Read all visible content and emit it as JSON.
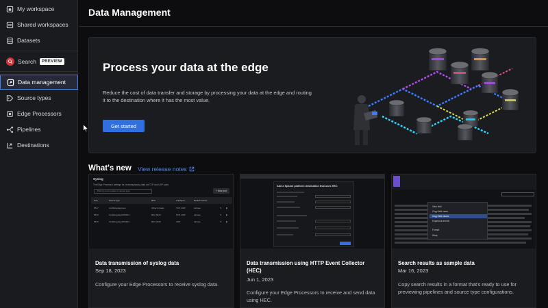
{
  "sidebar": {
    "items": [
      {
        "label": "My workspace",
        "icon": "home-icon"
      },
      {
        "label": "Shared workspaces",
        "icon": "shared-icon"
      },
      {
        "label": "Datasets",
        "icon": "database-icon"
      },
      {
        "label": "Search",
        "icon": "search-icon",
        "badge": "PREVIEW"
      },
      {
        "label": "Data management",
        "icon": "data-management-icon",
        "active": true
      },
      {
        "label": "Source types",
        "icon": "tag-icon"
      },
      {
        "label": "Edge Processors",
        "icon": "processor-icon"
      },
      {
        "label": "Pipelines",
        "icon": "pipeline-icon"
      },
      {
        "label": "Destinations",
        "icon": "destination-icon"
      }
    ]
  },
  "page": {
    "title": "Data Management"
  },
  "hero": {
    "heading": "Process your data at the edge",
    "description": "Reduce the cost of data transfer and storage by processing your data at the edge and routing it to the destination where it has the most value.",
    "cta": "Get started"
  },
  "whats_new": {
    "title": "What's new",
    "link": "View release notes",
    "cards": [
      {
        "title": "Data transmission of syslog data",
        "date": "Sep 18, 2023",
        "description": "Configure your Edge Processors to receive syslog data.",
        "thumb": {
          "heading": "Syslog",
          "subtitle": "The Edge Processor settings for receiving syslog data via TCP and UDP ports.",
          "filter_placeholder": "Filter by port number or source type",
          "new_port": "+ New port",
          "columns": [
            "Port",
            "Source type",
            "RFC",
            "Transport",
            "Default source"
          ],
          "rows": [
            [
              "5517",
              "zsm5cisyslog:mes",
              "Other formats",
              "TCP, UDP",
              "tunlnee"
            ],
            [
              "5516",
              "zsm5cisyslog:RC5424",
              "RFC 5424",
              "TCP, UDP",
              "tunlnee"
            ],
            [
              "5515",
              "zsm5cisyslog:RC5164",
              "RFC 3164",
              "UDP",
              "tunlnee"
            ]
          ]
        }
      },
      {
        "title": "Data transmission using HTTP Event Collector (HEC)",
        "date": "Jun 1, 2023",
        "description": "Configure your Edge Processors to receive and send data using HEC.",
        "thumb": {
          "form_title": "Add a Splunk platform destination that uses HEC"
        }
      },
      {
        "title": "Search results as sample data",
        "date": "Mar 16, 2023",
        "description": "Copy search results in a format that's ready to use for previewing pipelines and source type configurations.",
        "thumb": {
          "menu": [
            "View field",
            "Copy field name",
            "Copy field values",
            "Expand all events",
            "Format",
            "Wrap"
          ]
        }
      }
    ]
  },
  "colors": {
    "accent": "#2f6fdf",
    "link": "#4e8bf0",
    "active_border": "#4c7fe6",
    "search_brand": "#d4343a"
  }
}
